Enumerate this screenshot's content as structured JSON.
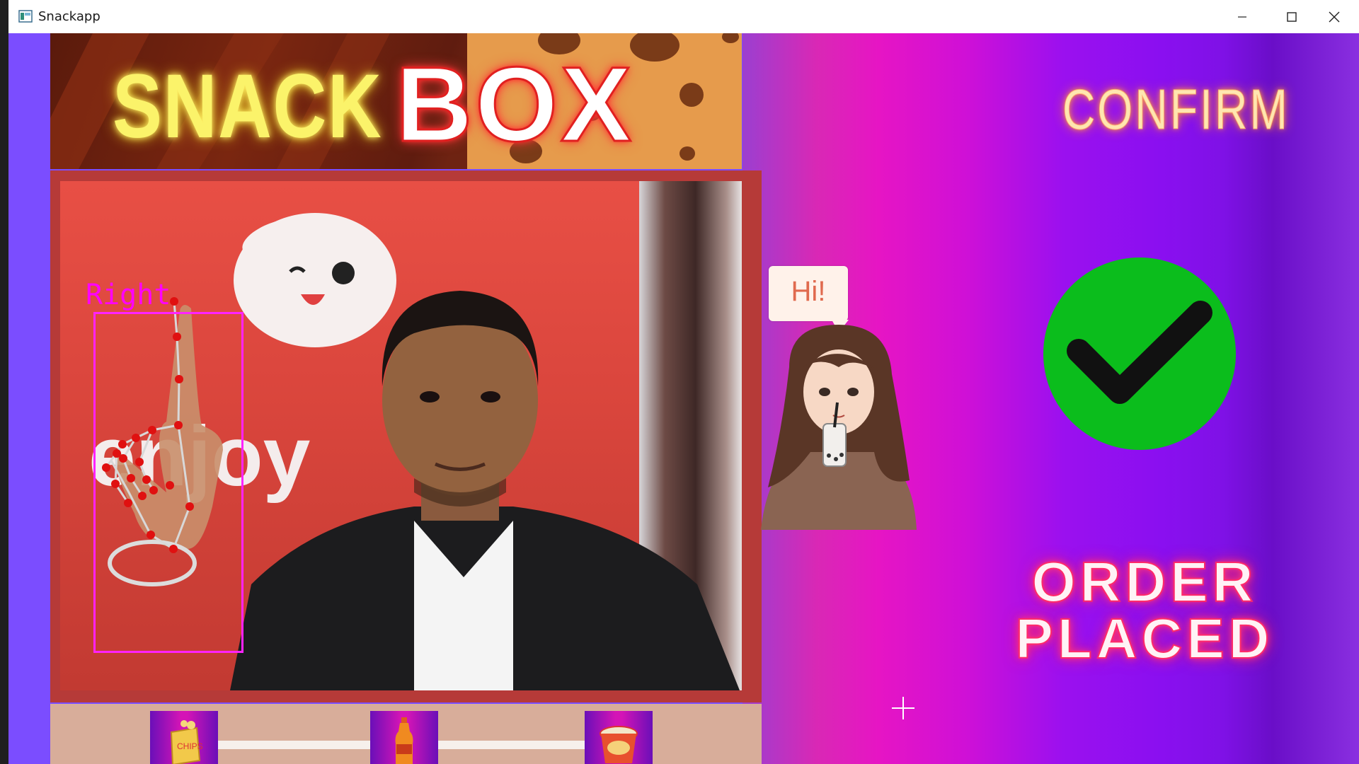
{
  "window": {
    "title": "Snackapp",
    "controls": {
      "minimize": "minimize-icon",
      "maximize": "maximize-icon",
      "close": "close-icon"
    }
  },
  "banner": {
    "word1": "SNACK",
    "word2": "BOX"
  },
  "camera": {
    "background_text": "enjoy",
    "hand_label": "Right"
  },
  "snack_bar": {
    "items": [
      {
        "name": "chips",
        "icon": "chips-packet-icon"
      },
      {
        "name": "drink",
        "icon": "soda-bottle-icon"
      },
      {
        "name": "noodles",
        "icon": "cup-noodles-icon"
      }
    ]
  },
  "assistant": {
    "bubble_text": "Hi!"
  },
  "confirm_panel": {
    "title": "CONFIRM",
    "status_line1": "ORDER",
    "status_line2": "PLACED",
    "check_color": "#0bbd1c"
  },
  "colors": {
    "left_bg": "#7b4dff",
    "hand_box": "#ff22ff",
    "landmark": "#e01010"
  }
}
